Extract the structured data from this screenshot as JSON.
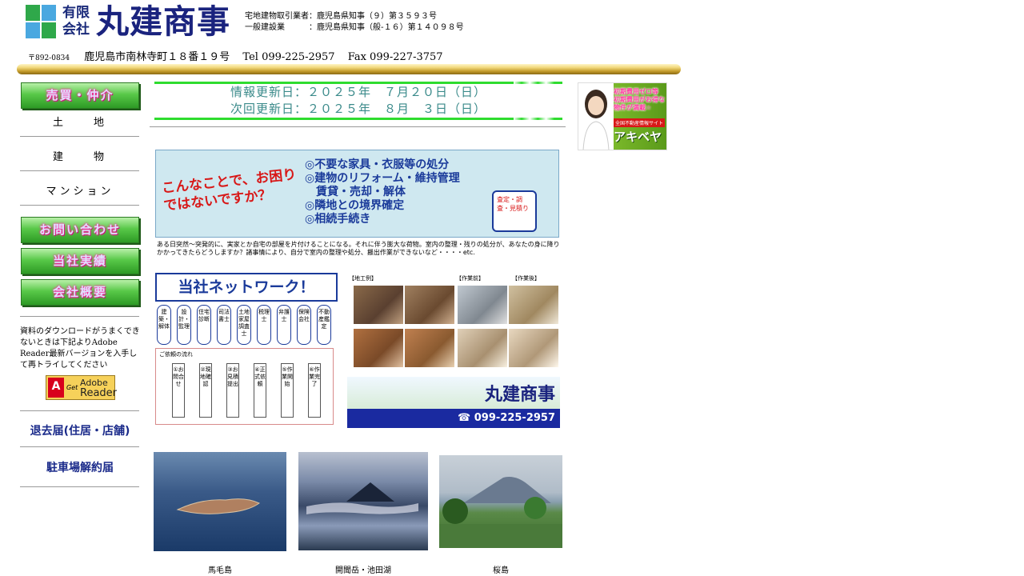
{
  "header": {
    "logo_kaisha": "有限会社",
    "company_name": "丸建商事",
    "license_lines": "宅地建物取引業者：鹿児島県知事（９）第３５９３号\n一般建設業　　　：鹿児島県知事（般-１６）第１４０９８号",
    "postal": "〒892-0834",
    "address": "鹿児島市南林寺町１８番１９号",
    "tel": "Tel 099-225-2957",
    "fax": "Fax 099-227-3757"
  },
  "sidebar": {
    "section_button": "売買・仲介",
    "links": [
      "土　　地",
      "建　　物",
      "マンション"
    ],
    "buttons": [
      "お問い合わせ",
      "当社実績",
      "会社概要"
    ],
    "adobe_text": "資料のダウンロードがうまくできないときは下記よりAdobe Reader最新バージョンを入手して再トライしてください",
    "adobe_badge": {
      "get": "Get",
      "brand_line1": "Adobe",
      "brand_line2": "Reader"
    },
    "form_links": [
      "退去届(住居・店舗)",
      "駐車場解約届"
    ]
  },
  "main": {
    "update_date": "情報更新日：２０２５年　７月２０日（日）",
    "next_update": "次回更新日：２０２５年　８月　３日（日）",
    "flyer": {
      "question": "こんなことで、お困りではないですか？",
      "services": [
        "◎不要な家具・衣服等の処分",
        "◎建物のリフォーム・維持管理",
        "　賃貸・売却・解体",
        "◎隣地との境界確定",
        "◎相続手続き"
      ],
      "box_text": "査定・調査・見積り",
      "body": "ある日突然～突発的に、実家とか自宅の部屋を片付けることになる。それに伴う膨大な荷物。室内の整理・残りの処分が、あなたの身に降りかかってきたらどうしますか？諸事情により、自分で室内の整理や処分、搬出作業ができないなど・・・・etc.",
      "network_title": "当社ネットワーク！",
      "roles": [
        "建築・解体",
        "設計・監理",
        "住宅診断",
        "司法書士",
        "土地家屋調査士",
        "税理士",
        "弁護士",
        "保険会社",
        "不動産鑑定"
      ],
      "flow_title": "ご依頼の流れ",
      "flow_steps": [
        "①お問合せ",
        "②現地確認",
        "③お見積提出",
        "④正式依頼",
        "⑤作業開始",
        "⑥作業完了"
      ],
      "photo_labels": [
        "【地工例】",
        "【作業前】",
        "【作業後】"
      ],
      "logo": "丸建商事",
      "phone": "☎ 099-225-2957"
    },
    "photos": [
      {
        "caption": "馬毛島"
      },
      {
        "caption": "開聞岳・池田湖"
      },
      {
        "caption": "桜島"
      }
    ]
  },
  "banner": {
    "text": "初期費用ゼロ等 初期費用がお得な物件が満載☆",
    "site": "全国不動産情報サイト",
    "brand": "アキベヤ"
  }
}
